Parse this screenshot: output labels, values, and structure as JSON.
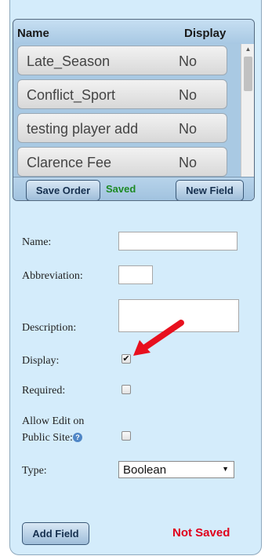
{
  "fields_list": {
    "col_name": "Name",
    "col_display": "Display",
    "rows": [
      {
        "name": "Late_Season",
        "display": "No"
      },
      {
        "name": "Conflict_Sport",
        "display": "No"
      },
      {
        "name": "testing player add",
        "display": "No"
      },
      {
        "name": "Clarence Fee",
        "display": "No"
      }
    ],
    "save_order_label": "Save Order",
    "status": "Saved",
    "new_field_label": "New Field"
  },
  "form": {
    "name_label": "Name:",
    "name_value": "",
    "abbreviation_label": "Abbreviation:",
    "abbreviation_value": "",
    "description_label": "Description:",
    "description_value": "",
    "display_label": "Display:",
    "display_checked": true,
    "required_label": "Required:",
    "required_checked": false,
    "allow_edit_label_line1": "Allow Edit on",
    "allow_edit_label_line2": "Public Site:",
    "help_glyph": "?",
    "allow_edit_checked": false,
    "type_label": "Type:",
    "type_value": "Boolean",
    "add_field_label": "Add Field",
    "form_status": "Not Saved"
  },
  "colors": {
    "panel_bg": "#d4ecfb",
    "saved": "#1d8a24",
    "not_saved": "#e0001b",
    "annotation_arrow": "#e8101e"
  }
}
